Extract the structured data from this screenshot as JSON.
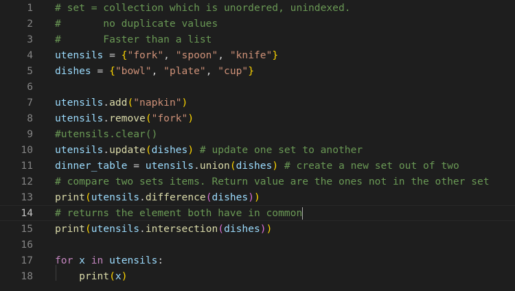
{
  "lines": [
    {
      "n": "1",
      "t": [
        [
          "cm",
          "# set = collection which is unordered, unindexed."
        ]
      ]
    },
    {
      "n": "2",
      "t": [
        [
          "cm",
          "#       no duplicate values"
        ]
      ]
    },
    {
      "n": "3",
      "t": [
        [
          "cm",
          "#       Faster than a list"
        ]
      ]
    },
    {
      "n": "4",
      "t": [
        [
          "vr",
          "utensils"
        ],
        [
          "",
          " = "
        ],
        [
          "p1",
          "{"
        ],
        [
          "st",
          "\"fork\""
        ],
        [
          "",
          ", "
        ],
        [
          "st",
          "\"spoon\""
        ],
        [
          "",
          ", "
        ],
        [
          "st",
          "\"knife\""
        ],
        [
          "p1",
          "}"
        ]
      ]
    },
    {
      "n": "5",
      "t": [
        [
          "vr",
          "dishes"
        ],
        [
          "",
          " = "
        ],
        [
          "p1",
          "{"
        ],
        [
          "st",
          "\"bowl\""
        ],
        [
          "",
          ", "
        ],
        [
          "st",
          "\"plate\""
        ],
        [
          "",
          ", "
        ],
        [
          "st",
          "\"cup\""
        ],
        [
          "p1",
          "}"
        ]
      ]
    },
    {
      "n": "6",
      "t": []
    },
    {
      "n": "7",
      "t": [
        [
          "vr",
          "utensils"
        ],
        [
          "",
          "."
        ],
        [
          "fn",
          "add"
        ],
        [
          "p1",
          "("
        ],
        [
          "st",
          "\"napkin\""
        ],
        [
          "p1",
          ")"
        ]
      ]
    },
    {
      "n": "8",
      "t": [
        [
          "vr",
          "utensils"
        ],
        [
          "",
          "."
        ],
        [
          "fn",
          "remove"
        ],
        [
          "p1",
          "("
        ],
        [
          "st",
          "\"fork\""
        ],
        [
          "p1",
          ")"
        ]
      ]
    },
    {
      "n": "9",
      "t": [
        [
          "cm",
          "#utensils.clear()"
        ]
      ]
    },
    {
      "n": "10",
      "t": [
        [
          "vr",
          "utensils"
        ],
        [
          "",
          "."
        ],
        [
          "fn",
          "update"
        ],
        [
          "p1",
          "("
        ],
        [
          "vr",
          "dishes"
        ],
        [
          "p1",
          ")"
        ],
        [
          "",
          " "
        ],
        [
          "cm",
          "# update one set to another"
        ]
      ]
    },
    {
      "n": "11",
      "t": [
        [
          "vr",
          "dinner_table"
        ],
        [
          "",
          " = "
        ],
        [
          "vr",
          "utensils"
        ],
        [
          "",
          "."
        ],
        [
          "fn",
          "union"
        ],
        [
          "p1",
          "("
        ],
        [
          "vr",
          "dishes"
        ],
        [
          "p1",
          ")"
        ],
        [
          "",
          " "
        ],
        [
          "cm",
          "# create a new set out of two"
        ]
      ]
    },
    {
      "n": "12",
      "t": [
        [
          "cm",
          "# compare two sets items. Return value are the ones not in the other set"
        ]
      ]
    },
    {
      "n": "13",
      "t": [
        [
          "fn",
          "print"
        ],
        [
          "p1",
          "("
        ],
        [
          "vr",
          "utensils"
        ],
        [
          "",
          "."
        ],
        [
          "fn",
          "difference"
        ],
        [
          "p2",
          "("
        ],
        [
          "vr",
          "dishes"
        ],
        [
          "p2",
          ")"
        ],
        [
          "p1",
          ")"
        ]
      ]
    },
    {
      "n": "14",
      "t": [
        [
          "cm",
          "# returns the element both have in common"
        ]
      ],
      "current": true
    },
    {
      "n": "15",
      "t": [
        [
          "fn",
          "print"
        ],
        [
          "p1",
          "("
        ],
        [
          "vr",
          "utensils"
        ],
        [
          "",
          "."
        ],
        [
          "fn",
          "intersection"
        ],
        [
          "p2",
          "("
        ],
        [
          "vr",
          "dishes"
        ],
        [
          "p2",
          ")"
        ],
        [
          "p1",
          ")"
        ]
      ]
    },
    {
      "n": "16",
      "t": []
    },
    {
      "n": "17",
      "t": [
        [
          "kw",
          "for"
        ],
        [
          "",
          " "
        ],
        [
          "vr",
          "x"
        ],
        [
          "",
          " "
        ],
        [
          "kw",
          "in"
        ],
        [
          "",
          " "
        ],
        [
          "vr",
          "utensils"
        ],
        [
          "",
          ":"
        ]
      ]
    },
    {
      "n": "18",
      "t": [
        [
          "",
          "    "
        ],
        [
          "fn",
          "print"
        ],
        [
          "p1",
          "("
        ],
        [
          "vr",
          "x"
        ],
        [
          "p1",
          ")"
        ]
      ]
    }
  ]
}
